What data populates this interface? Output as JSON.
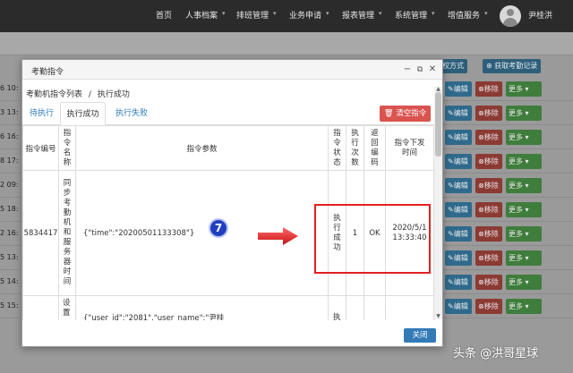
{
  "nav": {
    "items": [
      "首页",
      "人事档案",
      "排班管理",
      "业务申请",
      "报表管理",
      "系统管理",
      "增值服务"
    ],
    "user": "尹桂洪"
  },
  "background": {
    "buttons": [
      "授权方式",
      "获取考勤记录"
    ],
    "times": [
      "6 10:",
      "3 13:",
      "6 16:",
      "8 17:",
      "2 09:",
      "5 18:",
      "2 16:",
      "5 13:",
      "5 14:",
      "5 15:"
    ],
    "row_buttons": {
      "edit": "编辑",
      "delete": "移除",
      "more": "更多"
    }
  },
  "modal": {
    "title": "考勤指令",
    "breadcrumb": [
      "考勤机指令列表",
      "/",
      "执行成功"
    ],
    "tabs": [
      "待执行",
      "执行成功",
      "执行失败"
    ],
    "clear_button": "清空指令",
    "close_button": "关闭",
    "table": {
      "headers": [
        "指令编号",
        "指令名称",
        "指令参数",
        "指令状态",
        "执行次数",
        "返回编码",
        "指令下发时间"
      ],
      "rows": [
        {
          "id": "5834417",
          "name": "同步考勤机和服务器时间",
          "param": "{\"time\":\"20200501133308\"}",
          "status": "执行成功",
          "count": "1",
          "code": "OK",
          "time": "2020/5/1 13:33:40"
        },
        {
          "id": "",
          "name": "设置",
          "param": "{\"user_id\":\"2081\",\"user_name\":\"尹桂",
          "status": "执",
          "count": "",
          "code": "",
          "time": ""
        }
      ]
    }
  },
  "annotation": {
    "number": "7"
  },
  "watermark": "头条 @洪哥星球",
  "colors": {
    "nav_bg": "#2b2b2b",
    "danger": "#d9534f",
    "primary": "#337ab7",
    "highlight": "#e02020",
    "badge": "#1f3fbf"
  }
}
